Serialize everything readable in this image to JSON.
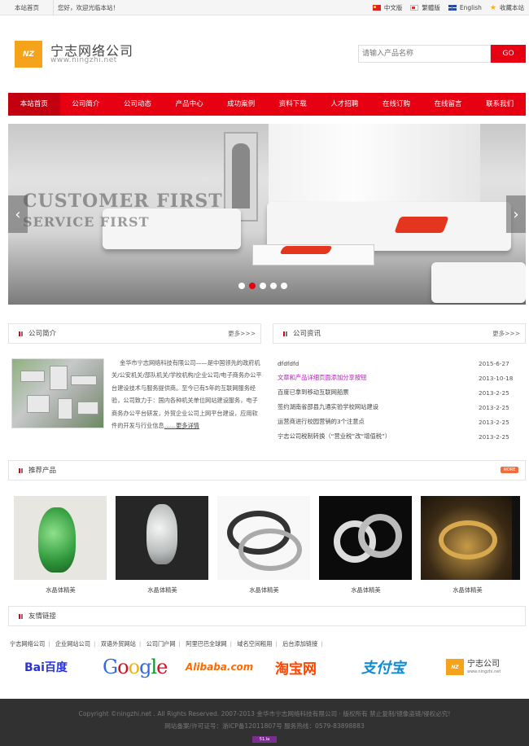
{
  "topbar": {
    "home": "本站首页",
    "welcome": "您好，欢迎光临本站！",
    "langs": [
      {
        "label": "中文版",
        "icon": "china-flag-icon"
      },
      {
        "label": "繁體版",
        "icon": "taiwan-flag-icon"
      },
      {
        "label": "English",
        "icon": "uk-flag-icon"
      },
      {
        "label": "收藏本站",
        "icon": "star-icon"
      }
    ]
  },
  "header": {
    "logo_mark": "NZ",
    "name_cn": "宁志网络公司",
    "name_en": "www.ningzhi.net",
    "search_placeholder": "请输入产品名称",
    "search_button": "GO"
  },
  "nav": [
    "本站首页",
    "公司简介",
    "公司动态",
    "产品中心",
    "成功案例",
    "资料下载",
    "人才招聘",
    "在线订购",
    "在线留言",
    "联系我们"
  ],
  "banner": {
    "line1": "CUSTOMER FIRST",
    "line2": "SERVICE FIRST",
    "prev": "‹",
    "next": "›",
    "slide_count": 5,
    "active_slide": 2
  },
  "about": {
    "title": "公司简介",
    "more": "更多>>>",
    "text": "金华市宁志网络科技有限公司——是中国领先的政府机关/公安机关/部队机关/学校机构/企业公司/电子商务办公平台建设技术与服务提供商。至今已有5年的互联网服务经验，公司致力于：国内各种机关单位网站建设服务，电子商务办公平台研发，外贸企业公司上网平台建设，应用软件的开发与行业信息",
    "detail": "……更多详情"
  },
  "news": {
    "title": "公司资讯",
    "more": "更多>>>",
    "items": [
      {
        "title": "dfdfdfd",
        "date": "2015-6-27"
      },
      {
        "title": "文章和产品详细页面添加分享按钮",
        "date": "2013-10-18"
      },
      {
        "title": "百度已拿到移动互联网船票",
        "date": "2013-2-25"
      },
      {
        "title": "签约湖南省邵县九通实验学校网站建设",
        "date": "2013-2-25"
      },
      {
        "title": "运营商进行校园营销的3个注意点",
        "date": "2013-2-25"
      },
      {
        "title": "宁志公司税制转换（“营业税”改“增值税”）",
        "date": "2013-2-25"
      }
    ]
  },
  "products": {
    "title": "推荐产品",
    "more": "MORE",
    "items": [
      "水晶体精美",
      "水晶体精美",
      "水晶体精美",
      "水晶体精美",
      "水晶体精美"
    ]
  },
  "links": {
    "title": "友情链接",
    "text_links": [
      "宁志网络公司",
      "企业网站公司",
      "双语外贸网站",
      "公司门户网",
      "阿里巴巴全球网",
      "域名空间租用",
      "后台添加链接"
    ],
    "logos": {
      "baidu": "Bai百度",
      "google": "Google",
      "alibaba": "Alibaba.com",
      "taobao": "淘宝网",
      "alipay": "支付宝",
      "ningzhi_cn": "宁志公司",
      "ningzhi_en": "www.ningzhi.net"
    }
  },
  "footer": {
    "line1": "Copyright ©ningzhi.net . All Rights Reserved. 2007-2013 金华市宁志网络科技有限公司 · 版权所有 禁止复制/镜像盗链/侵权必究!",
    "line2": "网站备案/许可证号：浙ICP备12011807号 服务热线：0579-83898883",
    "badge": "51.la"
  }
}
